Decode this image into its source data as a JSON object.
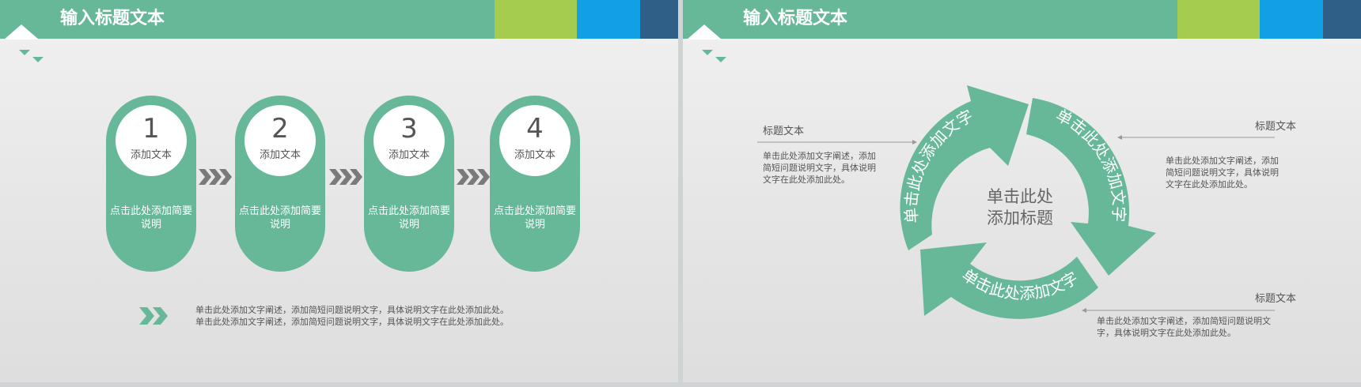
{
  "header": {
    "title": "输入标题文本"
  },
  "colors": {
    "green": "#67b899",
    "lime": "#a5cb4f",
    "blue": "#10a0e3",
    "navy": "#2f5f86"
  },
  "steps": [
    {
      "num": "1",
      "label": "添加文本",
      "desc": "点击此处添加简要说明"
    },
    {
      "num": "2",
      "label": "添加文本",
      "desc": "点击此处添加简要说明"
    },
    {
      "num": "3",
      "label": "添加文本",
      "desc": "点击此处添加简要说明"
    },
    {
      "num": "4",
      "label": "添加文本",
      "desc": "点击此处添加简要说明"
    }
  ],
  "note_lines": [
    "单击此处添加文字阐述，添加简短问题说明文字，具体说明文字在此处添加此处。",
    "单击此处添加文字阐述，添加简短问题说明文字，具体说明文字在此处添加此处。"
  ],
  "cycle": {
    "center_line1": "单击此处",
    "center_line2": "添加标题",
    "arrow_text": "单击此处添加文字"
  },
  "callouts": [
    {
      "title": "标题文本",
      "text": "单击此处添加文字阐述，添加简短问题说明文字，具体说明文字在此处添加此处。"
    },
    {
      "title": "标题文本",
      "text": "单击此处添加文字阐述，添加简短问题说明文字，具体说明文字在此处添加此处。"
    },
    {
      "title": "标题文本",
      "text": "单击此处添加文字阐述，添加简短问题说明文字，具体说明文字在此处添加此处。"
    }
  ]
}
